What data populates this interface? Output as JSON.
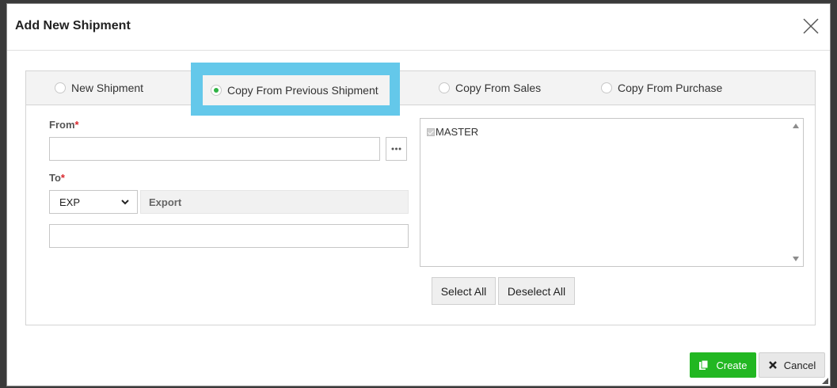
{
  "dialog": {
    "title": "Add New Shipment",
    "close_icon": "close-icon"
  },
  "tabs": [
    {
      "label": "New Shipment",
      "checked": false
    },
    {
      "label": "Copy From Previous Shipment",
      "checked": true
    },
    {
      "label": "Copy From Sales",
      "checked": false
    },
    {
      "label": "Copy From Purchase",
      "checked": false
    }
  ],
  "form": {
    "from_label": "From",
    "from_value": "",
    "to_label": "To",
    "required_mark": "*",
    "to_code": "EXP",
    "to_name": "Export",
    "to_extra_value": ""
  },
  "list": {
    "items": [
      {
        "label": "MASTER",
        "checked": true,
        "disabled": true
      }
    ]
  },
  "buttons": {
    "select_all": "Select All",
    "deselect_all": "Deselect All",
    "create": "Create",
    "cancel": "Cancel"
  },
  "colors": {
    "highlight": "#64c8ea",
    "create_green": "#22b722",
    "required_red": "#d9262c",
    "radio_checked": "#2fb344"
  }
}
